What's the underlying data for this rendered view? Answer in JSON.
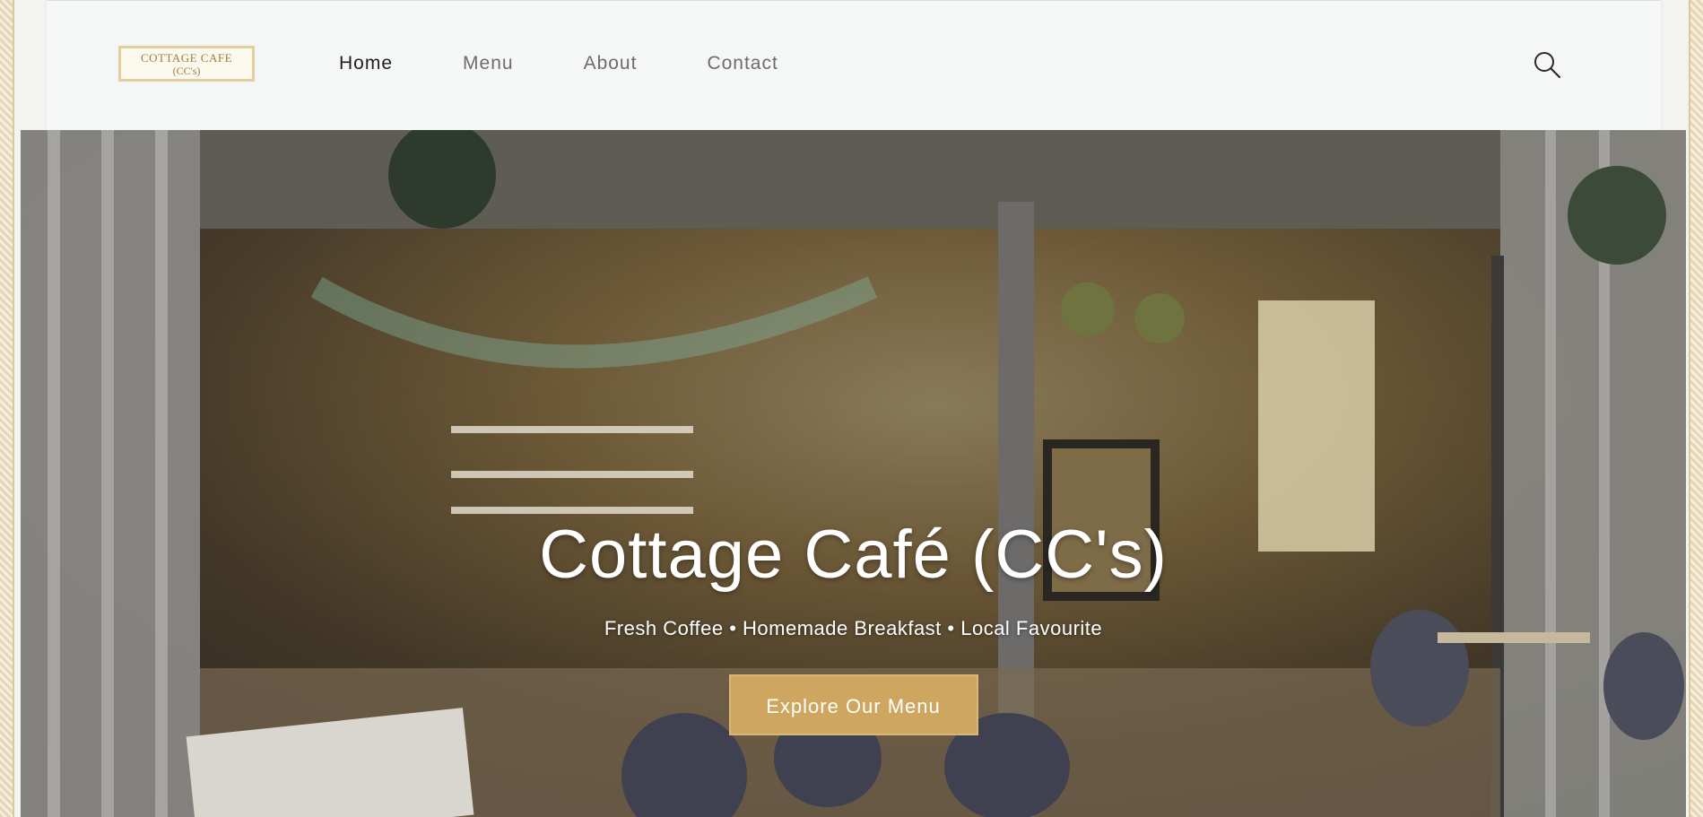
{
  "brand": {
    "logo_line1": "COTTAGE CAFE",
    "logo_line2": "(CC's)",
    "accent_color": "#cfa660"
  },
  "nav": {
    "items": [
      {
        "label": "Home",
        "active": true
      },
      {
        "label": "Menu",
        "active": false
      },
      {
        "label": "About",
        "active": false
      },
      {
        "label": "Contact",
        "active": false
      }
    ],
    "search_icon": "search-icon"
  },
  "hero": {
    "title": "Cottage Café (CC's)",
    "subtitle": "Fresh Coffee • Homemade Breakfast • Local Favourite",
    "cta_label": "Explore Our Menu",
    "image_description_icon": "cafe-storefront-photo"
  }
}
